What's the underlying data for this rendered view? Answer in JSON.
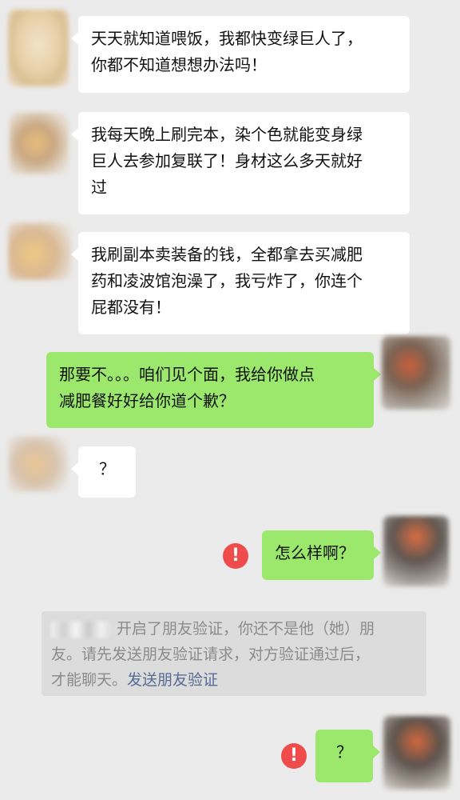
{
  "messages": [
    {
      "side": "left",
      "text_lines": [
        "天天就知道喂饭，我都快变绿巨人了，",
        "你都不知道想想办法吗！"
      ]
    },
    {
      "side": "left",
      "text_lines": [
        "我每天晚上刷完本，染个色就能变身绿",
        "巨人去参加复联了！身材这么多天就好",
        "过"
      ]
    },
    {
      "side": "left",
      "text_lines": [
        "我刷副本卖装备的钱，全都拿去买减肥",
        "药和凌波馆泡澡了，我亏炸了，你连个",
        "屁都没有！"
      ]
    },
    {
      "side": "right",
      "text_lines": [
        "那要不。。。咱们见个面，我给你做点",
        "减肥餐好好给你道个歉？"
      ]
    },
    {
      "side": "left",
      "text_lines": [
        "？"
      ]
    },
    {
      "side": "right",
      "text_lines": [
        "怎么样啊？"
      ],
      "failed": true
    },
    {
      "side": "right",
      "text_lines": [
        "？"
      ],
      "failed": true
    }
  ],
  "error_icon": "!",
  "system_notice": {
    "line1": "开启了朋友验证，你还不是他（她）朋",
    "line2": "友。请先发送朋友验证请求，对方验证通过后，",
    "line3_prefix": "才能聊天。",
    "link_text": "发送朋友验证"
  },
  "colors": {
    "background": "#ebebeb",
    "bubble_self": "#9be86d",
    "bubble_other": "#ffffff",
    "error": "#ef4b4b",
    "link": "#576b95",
    "system_text": "#8b8b8b"
  }
}
